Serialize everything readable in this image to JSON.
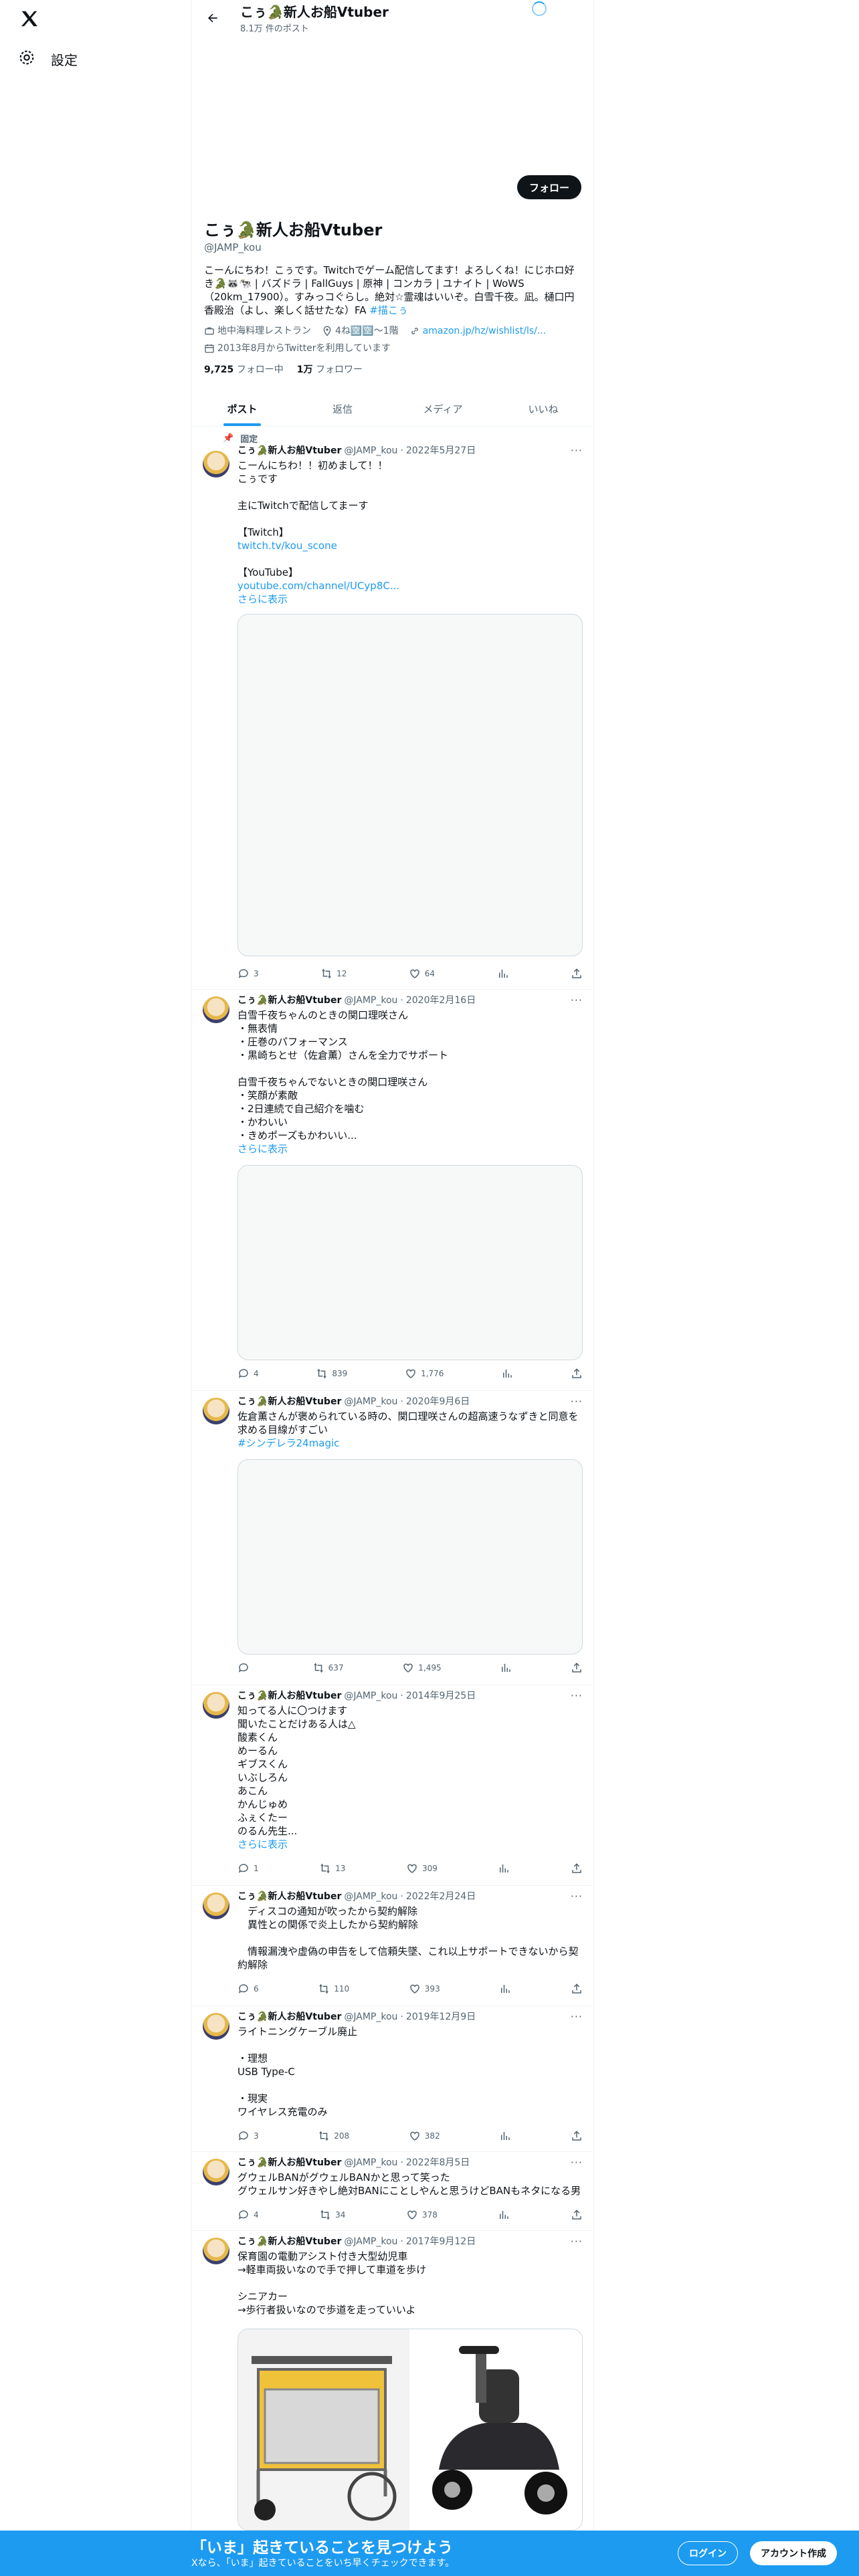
{
  "nav": {
    "settings_label": "設定"
  },
  "header": {
    "title": "こぅ🐊新人お船Vtuber",
    "post_count": "8.1万 件のポスト"
  },
  "profile": {
    "follow_label": "フォロー",
    "name": "こぅ🐊新人お船Vtuber",
    "handle": "@JAMP_kou",
    "bio": "こーんにちわ！こぅです。Twitchでゲーム配信してます！よろしくね！にじホロ好き🐊🦝🐄 | バズドラ | FallGuys | 原神 | コンカラ | ユナイト | WoWS（20km_17900）。すみっコぐらし。絶対☆霊魂はいいぞ。白雪千夜。凪。樋口円香殿治（よし、楽しく話せたな）FA",
    "bio_tag": "#描こぅ",
    "location": "地中海料理レストラン",
    "birth": "4ね🈳🈳〜1階",
    "link": "amazon.jp/hz/wishlist/ls/...",
    "joined": "2013年8月からTwitterを利用しています",
    "following_count": "9,725",
    "following_label": "フォロー中",
    "followers_count": "1万",
    "followers_label": "フォロワー"
  },
  "tabs": [
    "ポスト",
    "返信",
    "メディア",
    "いいね"
  ],
  "tweets": [
    {
      "pinned_label": "固定",
      "name": "こぅ🐊新人お船Vtuber",
      "handle": "@JAMP_kou",
      "date": "2022年5月27日",
      "text": "こーんにちわ！！初めまして！！\nこぅです\n\n主にTwitchで配信してまーす\n\n【Twitch】",
      "link1": "twitch.tv/kou_scone",
      "text2": "【YouTube】",
      "link2": "youtube.com/channel/UCyp8C...",
      "show_more": "さらに表示",
      "replies": "3",
      "reposts": "12",
      "likes": "64"
    },
    {
      "name": "こぅ🐊新人お船Vtuber",
      "handle": "@JAMP_kou",
      "date": "2020年2月16日",
      "text": "白雪千夜ちゃんのときの関口理咲さん\n・無表情\n・圧巻のパフォーマンス\n・黒崎ちとせ（佐倉薫）さんを全力でサポート\n\n白雪千夜ちゃんでないときの関口理咲さん\n・笑顔が素敵\n・2日連続で自己紹介を噛む\n・かわいい\n・きめポーズもかわいい...",
      "show_more": "さらに表示",
      "replies": "4",
      "reposts": "839",
      "likes": "1,776"
    },
    {
      "name": "こぅ🐊新人お船Vtuber",
      "handle": "@JAMP_kou",
      "date": "2020年9月6日",
      "text": "佐倉薫さんが褒められている時の、関口理咲さんの超高速うなずきと同意を求める目線がすごい",
      "tag": "#シンデレラ24magic",
      "replies": "",
      "reposts": "637",
      "likes": "1,495"
    },
    {
      "name": "こぅ🐊新人お船Vtuber",
      "handle": "@JAMP_kou",
      "date": "2014年9月25日",
      "text": "知ってる人に〇つけます\n聞いたことだけある人は△\n酸素くん\nめーるん\nギブスくん\nいぶしろん\nあこん\nかんじゅめ\nふぇくたー\nのるん先生...",
      "show_more": "さらに表示",
      "replies": "1",
      "reposts": "13",
      "likes": "309"
    },
    {
      "name": "こぅ🐊新人お船Vtuber",
      "handle": "@JAMP_kou",
      "date": "2022年2月24日",
      "text": "　ディスコの通知が吹ったから契約解除\n　異性との関係で炎上したから契約解除\n\n　情報漏洩や虚偽の申告をして信頼失墜、これ以上サポートできないから契約解除",
      "replies": "6",
      "reposts": "110",
      "likes": "393"
    },
    {
      "name": "こぅ🐊新人お船Vtuber",
      "handle": "@JAMP_kou",
      "date": "2019年12月9日",
      "text": "ライトニングケーブル廃止\n\n・理想\nUSB Type-C\n\n・現実\nワイヤレス充電のみ",
      "replies": "3",
      "reposts": "208",
      "likes": "382"
    },
    {
      "name": "こぅ🐊新人お船Vtuber",
      "handle": "@JAMP_kou",
      "date": "2022年8月5日",
      "text": "グウェルBANがグウェルBANかと思って笑った\nグウェルサン好きやし絶対BANにことしやんと思うけどBANもネタになる男",
      "replies": "4",
      "reposts": "34",
      "likes": "378"
    },
    {
      "name": "こぅ🐊新人お船Vtuber",
      "handle": "@JAMP_kou",
      "date": "2017年9月12日",
      "text": "保育園の電動アシスト付き大型幼児車\n→軽車両扱いなので手で押して車道を歩け\n\nシニアカー\n→歩行者扱いなので歩道を走っていいよ"
    }
  ],
  "banner": {
    "title": "「いま」起きていることを見つけよう",
    "sub": "Xなら、「いま」起きていることをいち早くチェックできます。",
    "login": "ログイン",
    "signup": "アカウント作成"
  },
  "colors": {
    "accent": "#1d9bf0",
    "text": "#0f1419",
    "muted": "#536471"
  }
}
